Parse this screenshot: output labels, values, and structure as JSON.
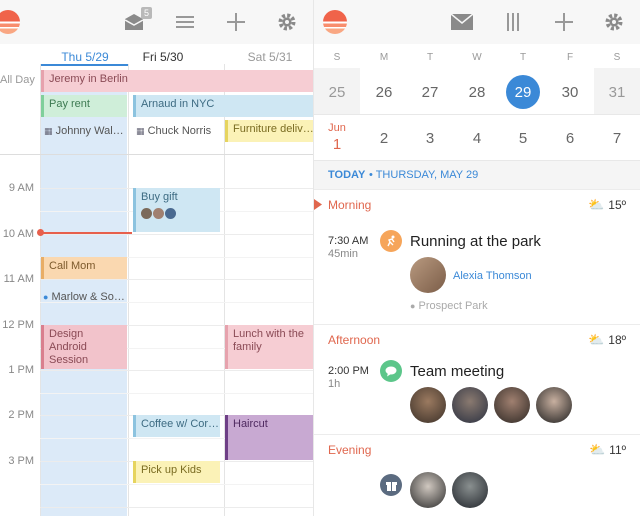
{
  "colors": {
    "accent_red": "#e0674e",
    "today_blue": "#3b89d7",
    "event_pink": "#f6cdd3",
    "event_green": "#cfeed9",
    "event_blue": "#cfe7f3",
    "event_yellow": "#fbf2b7",
    "event_orange": "#fad8b0",
    "event_purple": "#c8a9d2"
  },
  "left": {
    "toolbar": {
      "inbox_badge": "5",
      "icons": [
        "sunrise-logo-icon",
        "inbox-icon",
        "menu-icon",
        "add-icon",
        "gear-icon"
      ]
    },
    "days": [
      {
        "label": "Thu 5/29",
        "color": "#3b89d7"
      },
      {
        "label": "Fri 5/30",
        "color": "#333333"
      },
      {
        "label": "Sat 5/31",
        "color": "#999999"
      }
    ],
    "allday_label": "All Day",
    "hours": [
      "9 AM",
      "10 AM",
      "11 AM",
      "12 PM",
      "1 PM",
      "2 PM",
      "3 PM"
    ],
    "events": {
      "jeremy": "Jeremy in Berlin",
      "pay_rent": "Pay rent",
      "arnaud": "Arnaud in NYC",
      "johnny": "Johnny Wal…",
      "chuck": "Chuck Norris",
      "furniture": "Furniture deliv…",
      "buy_gift": "Buy gift",
      "call_mom": "Call Mom",
      "marlow": "Marlow & So…",
      "design": "Design Android Session",
      "lunch": "Lunch with the family",
      "haircut": "Haircut",
      "coffee": "Coffee w/ Cor…",
      "pickup": "Pick up Kids"
    }
  },
  "right": {
    "toolbar": {
      "icons": [
        "sunrise-logo-icon",
        "mail-icon",
        "week-view-icon",
        "add-icon",
        "gear-icon"
      ]
    },
    "weekdays": [
      "S",
      "M",
      "T",
      "W",
      "T",
      "F",
      "S"
    ],
    "week1": [
      "25",
      "26",
      "27",
      "28",
      "29",
      "30",
      "31"
    ],
    "week2_month": "Jun",
    "week2": [
      "1",
      "2",
      "3",
      "4",
      "5",
      "6",
      "7"
    ],
    "agenda": {
      "today": "TODAY",
      "date": "• THURSDAY, MAY 29",
      "morning": {
        "label": "Morning",
        "temp": "15º"
      },
      "afternoon": {
        "label": "Afternoon",
        "temp": "18º"
      },
      "evening": {
        "label": "Evening",
        "temp": "11º"
      },
      "run": {
        "time": "7:30 AM",
        "duration": "45min",
        "title": "Running at the park",
        "attendee": "Alexia Thomson",
        "location": "Prospect Park"
      },
      "meeting": {
        "time": "2:00 PM",
        "duration": "1h",
        "title": "Team meeting"
      }
    }
  }
}
